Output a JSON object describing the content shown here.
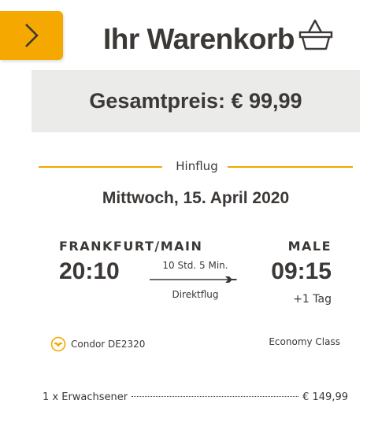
{
  "header": {
    "title": "Ihr Warenkorb",
    "total_price": "Gesamtpreis: € 99,99"
  },
  "colors": {
    "accent": "#f4a800",
    "panel": "#ebebe9",
    "text": "#3b3836"
  },
  "icons": {
    "collapse": "chevron-right-icon",
    "basket": "basket-icon",
    "airline": "condor-logo-icon",
    "plane": "plane-icon"
  },
  "flight": {
    "direction": "Hinflug",
    "date": "Mittwoch, 15. April 2020",
    "origin": {
      "city": "FRANKFURT/MAIN",
      "time": "20:10"
    },
    "destination": {
      "city": "MALE",
      "time": "09:15",
      "day_offset": "+1 Tag"
    },
    "duration": "10 Std. 5 Min.",
    "stops": "Direktflug",
    "airline": "Condor DE2320",
    "cabin": "Economy Class"
  },
  "passengers": [
    {
      "label": "1 x Erwachsener",
      "price": "€ 149,99"
    }
  ]
}
